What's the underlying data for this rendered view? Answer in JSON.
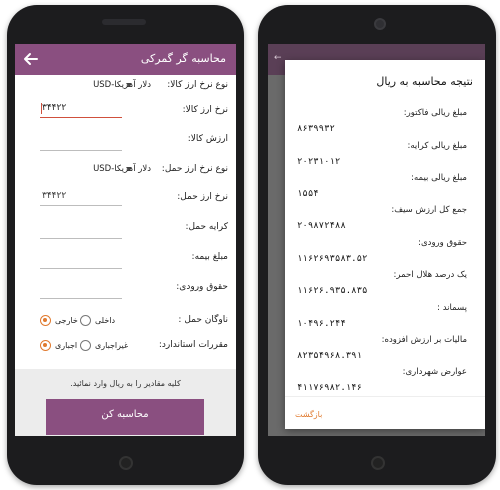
{
  "left_screen": {
    "title": "محاسبه گر گمرکی",
    "fields": {
      "goods_rate_type_label": "نوع نرخ ارز کالا:",
      "goods_rate_type_value": "دلار آمریکا-USD",
      "goods_rate_label": "نرخ ارز کالا:",
      "goods_rate_value": "۳۴۴۲۲",
      "goods_value_label": "ارزش کالا:",
      "goods_value_value": "",
      "shipping_rate_type_label": "نوع نرخ ارز حمل:",
      "shipping_rate_type_value": "دلار آمریکا-USD",
      "shipping_rate_label": "نرخ ارز حمل:",
      "shipping_rate_value": "۳۴۴۲۲",
      "freight_label": "کرایه حمل:",
      "freight_value": "",
      "insurance_label": "مبلغ بیمه:",
      "insurance_value": "",
      "duties_label": "حقوق ورودی:",
      "duties_value": ""
    },
    "fleet": {
      "label": "ناوگان حمل :",
      "options": [
        "خارجی",
        "داخلی"
      ],
      "selected": "خارجی"
    },
    "standards": {
      "label": "مقررات استاندارد:",
      "options": [
        "اجباری",
        "غیراجباری"
      ],
      "selected": "اجباری"
    },
    "footer_note": "کلیه مقادیر را به ریال وارد نمائید.",
    "calculate_button": "محاسبه کن"
  },
  "right_screen": {
    "dialog_title": "نتیجه محاسبه به ریال",
    "results": [
      {
        "label": "مبلغ ریالی فاکتور:",
        "value": "۸۶۳۹۹۳۲"
      },
      {
        "label": "مبلغ ریالی کرایه:",
        "value": "۲۰۲۳۱۰۱۲"
      },
      {
        "label": "مبلغ ریالی بیمه:",
        "value": "۱۵۵۴"
      },
      {
        "label": "جمع کل ارزش سیف:",
        "value": "۲۰۹۸۷۲۴۸۸"
      },
      {
        "label": "حقوق ورودی:",
        "value": "۱۱۶۲۶۹۳۵۸۳.۵۲"
      },
      {
        "label": "یک درصد هلال احمر:",
        "value": "۱۱۶۲۶.۹۳۵.۸۳۵"
      },
      {
        "label": "پسماند :",
        "value": "۱۰۴۹۶.۲۴۴"
      },
      {
        "label": "مالیات بر ارزش افزوده:",
        "value": "۸۲۳۵۴۹۶۸.۳۹۱"
      },
      {
        "label": "عوارض شهرداری:",
        "value": "۴۱۱۷۶۹۸۲.۱۴۶"
      }
    ],
    "return_button": "بازگشت"
  }
}
